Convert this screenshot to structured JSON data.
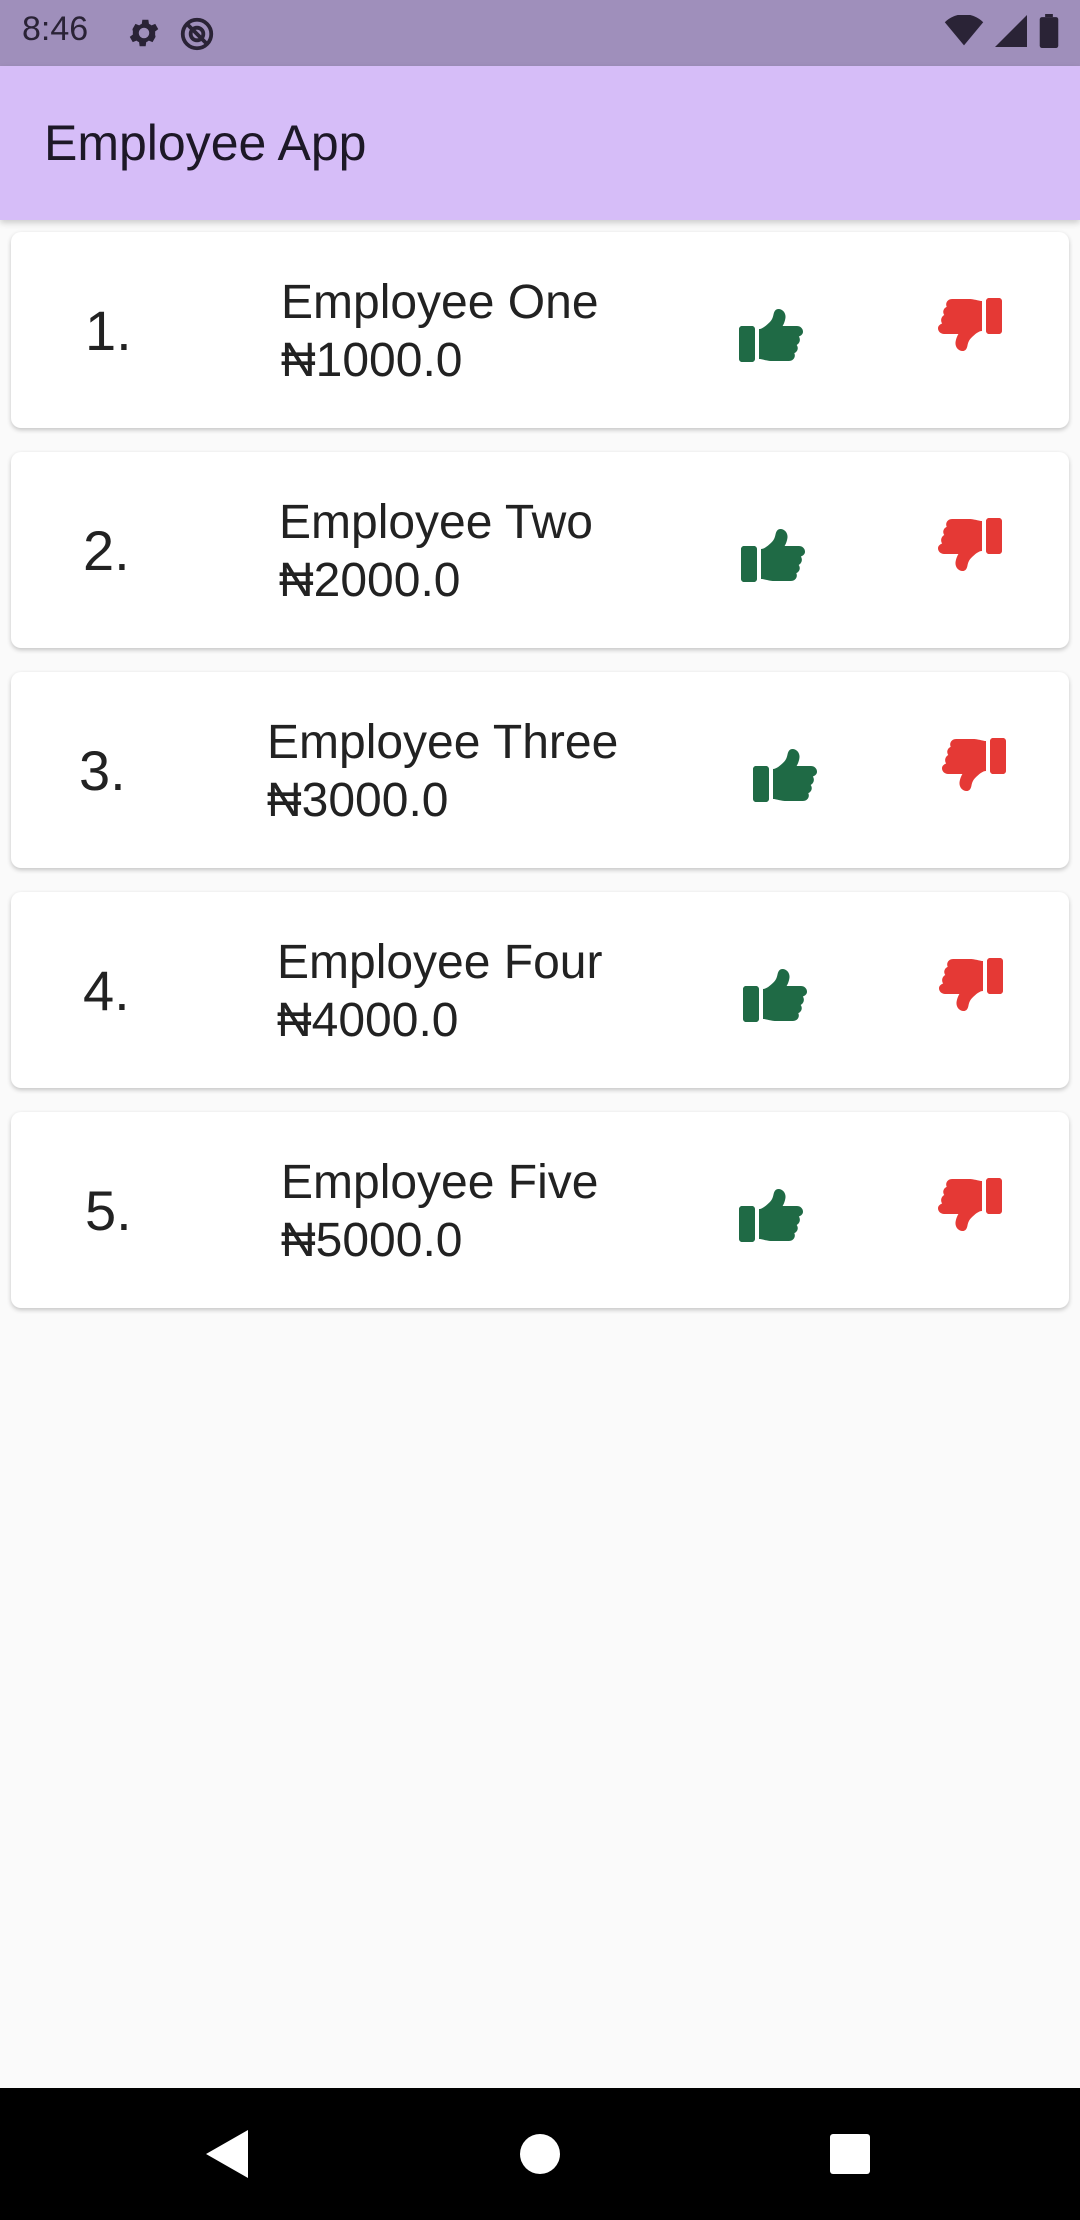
{
  "status_bar": {
    "time": "8:46",
    "icons": [
      "settings-icon",
      "do-not-disturb-icon",
      "wifi-icon",
      "signal-icon",
      "battery-icon"
    ]
  },
  "app_bar": {
    "title": "Employee App",
    "background_color": "#d6bdf8"
  },
  "employees": [
    {
      "number": "1.",
      "name": "Employee One",
      "salary": "₦1000.0"
    },
    {
      "number": "2.",
      "name": "Employee Two",
      "salary": "₦2000.0"
    },
    {
      "number": "3.",
      "name": "Employee Three",
      "salary": "₦3000.0"
    },
    {
      "number": "4.",
      "name": "Employee Four",
      "salary": "₦4000.0"
    },
    {
      "number": "5.",
      "name": "Employee Five",
      "salary": "₦5000.0"
    }
  ],
  "actions": {
    "like_icon": "thumbs-up-icon",
    "dislike_icon": "thumbs-down-icon",
    "like_color": "#1f6a45",
    "dislike_color": "#e53935"
  },
  "nav_bar": {
    "icons": [
      "back-icon",
      "home-icon",
      "recents-icon"
    ]
  }
}
